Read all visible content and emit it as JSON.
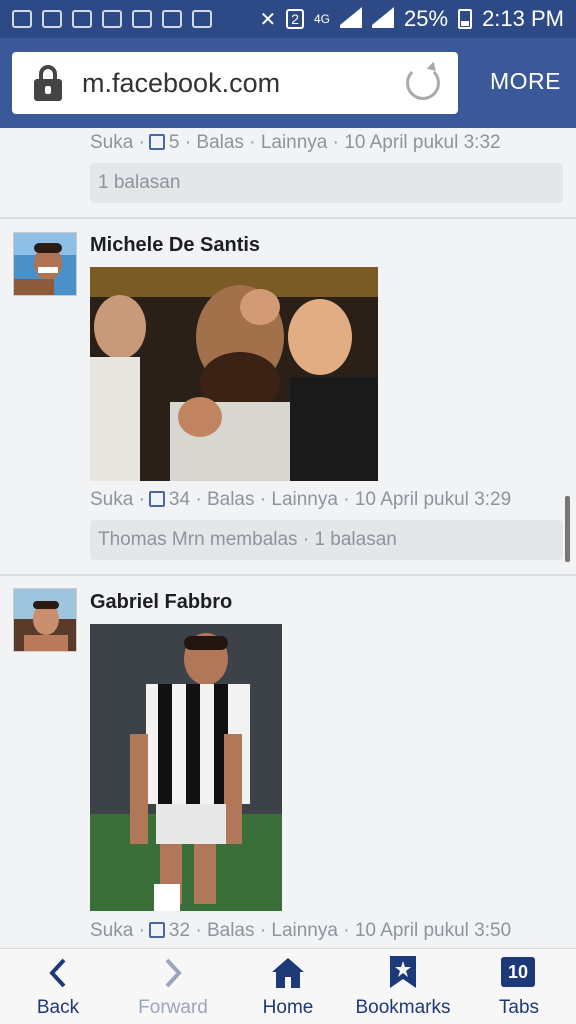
{
  "status_bar": {
    "battery": "25%",
    "time": "2:13 PM",
    "sim": "2",
    "network": "4G"
  },
  "browser": {
    "url": "m.facebook.com",
    "more_label": "MORE"
  },
  "comments": [
    {
      "actions": {
        "like": "Suka",
        "like_count": "5",
        "reply": "Balas",
        "more": "Lainnya",
        "timestamp": "10 April pukul 3:32"
      },
      "reply_summary": "1 balasan"
    },
    {
      "name": "Michele De Santis",
      "actions": {
        "like": "Suka",
        "like_count": "34",
        "reply": "Balas",
        "more": "Lainnya",
        "timestamp": "10 April pukul 3:29"
      },
      "reply_summary": "Thomas Mrn membalas · 1 balasan"
    },
    {
      "name": "Gabriel Fabbro",
      "actions": {
        "like": "Suka",
        "like_count": "32",
        "reply": "Balas",
        "more": "Lainnya",
        "timestamp": "10 April pukul 3:50"
      }
    }
  ],
  "bottom_nav": {
    "back": "Back",
    "forward": "Forward",
    "home": "Home",
    "bookmarks": "Bookmarks",
    "tabs": "Tabs",
    "tab_count": "10"
  },
  "colors": {
    "brand": "#3b5998",
    "status_bar": "#2e4a86",
    "link": "#4b67a1",
    "muted": "#8d949e"
  }
}
